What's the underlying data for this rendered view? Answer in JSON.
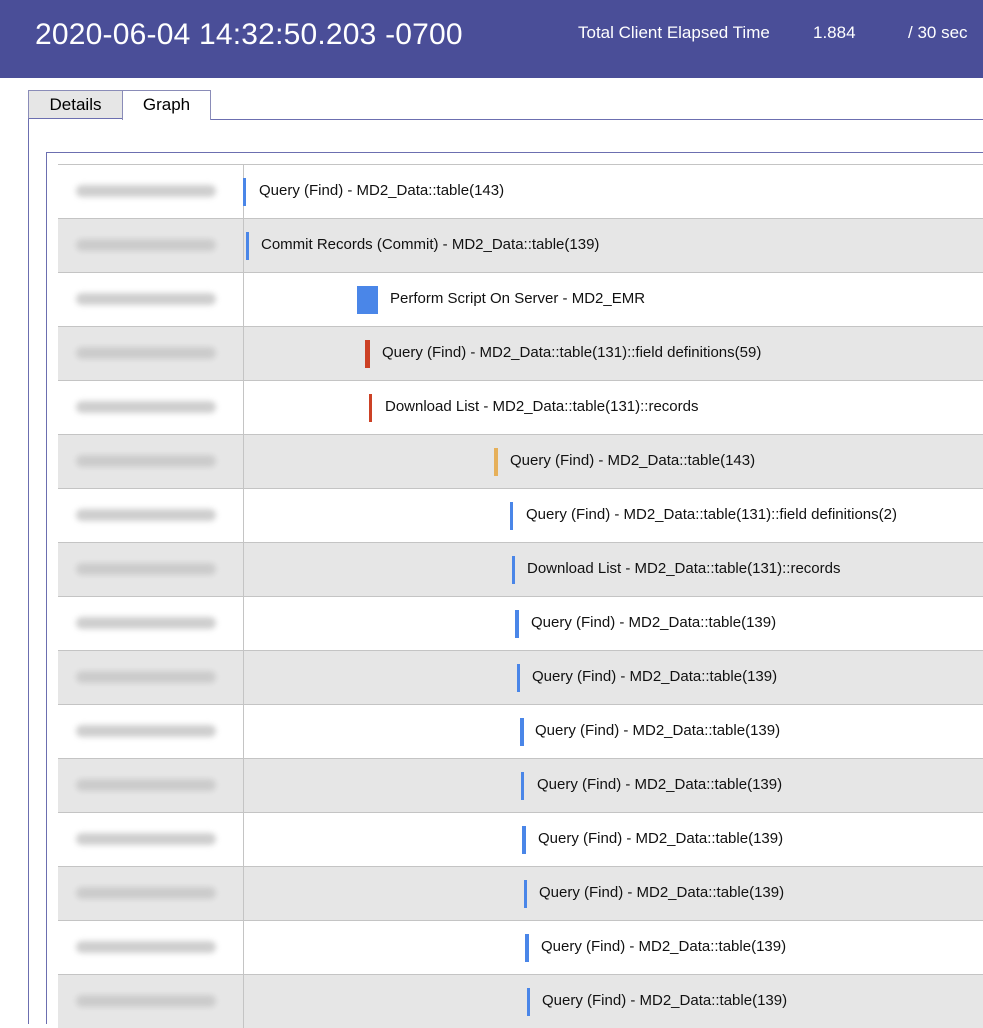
{
  "header": {
    "timestamp": "2020-06-04 14:32:50.203 -0700",
    "elapsed_label": "Total Client Elapsed Time",
    "elapsed_value": "1.884",
    "elapsed_limit": "/ 30 sec"
  },
  "tabs": [
    {
      "label": "Details",
      "active": false
    },
    {
      "label": "Graph",
      "active": true
    }
  ],
  "colors": {
    "header_bg": "#4a4e98",
    "bar_blue": "#4a86e8",
    "bar_red": "#cc4125",
    "bar_orange": "#e6b05a",
    "row_alt": "#e6e6e6"
  },
  "rows": [
    {
      "label": "Query (Find) - MD2_Data::table(143)",
      "bar_color": "bar_blue"
    },
    {
      "label": "Commit Records (Commit) - MD2_Data::table(139)",
      "bar_color": "bar_blue"
    },
    {
      "label": "Perform Script On Server - MD2_EMR",
      "bar_color": "bar_blue"
    },
    {
      "label": "Query (Find) - MD2_Data::table(131)::field definitions(59)",
      "bar_color": "bar_red"
    },
    {
      "label": "Download List - MD2_Data::table(131)::records",
      "bar_color": "bar_red"
    },
    {
      "label": "Query (Find) - MD2_Data::table(143)",
      "bar_color": "bar_orange"
    },
    {
      "label": "Query (Find) - MD2_Data::table(131)::field definitions(2)",
      "bar_color": "bar_blue"
    },
    {
      "label": "Download List - MD2_Data::table(131)::records",
      "bar_color": "bar_blue"
    },
    {
      "label": "Query (Find) - MD2_Data::table(139)",
      "bar_color": "bar_blue"
    },
    {
      "label": "Query (Find) - MD2_Data::table(139)",
      "bar_color": "bar_blue"
    },
    {
      "label": "Query (Find) - MD2_Data::table(139)",
      "bar_color": "bar_blue"
    },
    {
      "label": "Query (Find) - MD2_Data::table(139)",
      "bar_color": "bar_blue"
    },
    {
      "label": "Query (Find) - MD2_Data::table(139)",
      "bar_color": "bar_blue"
    },
    {
      "label": "Query (Find) - MD2_Data::table(139)",
      "bar_color": "bar_blue"
    },
    {
      "label": "Query (Find) - MD2_Data::table(139)",
      "bar_color": "bar_blue"
    },
    {
      "label": "Query (Find) - MD2_Data::table(139)",
      "bar_color": "bar_blue"
    }
  ]
}
